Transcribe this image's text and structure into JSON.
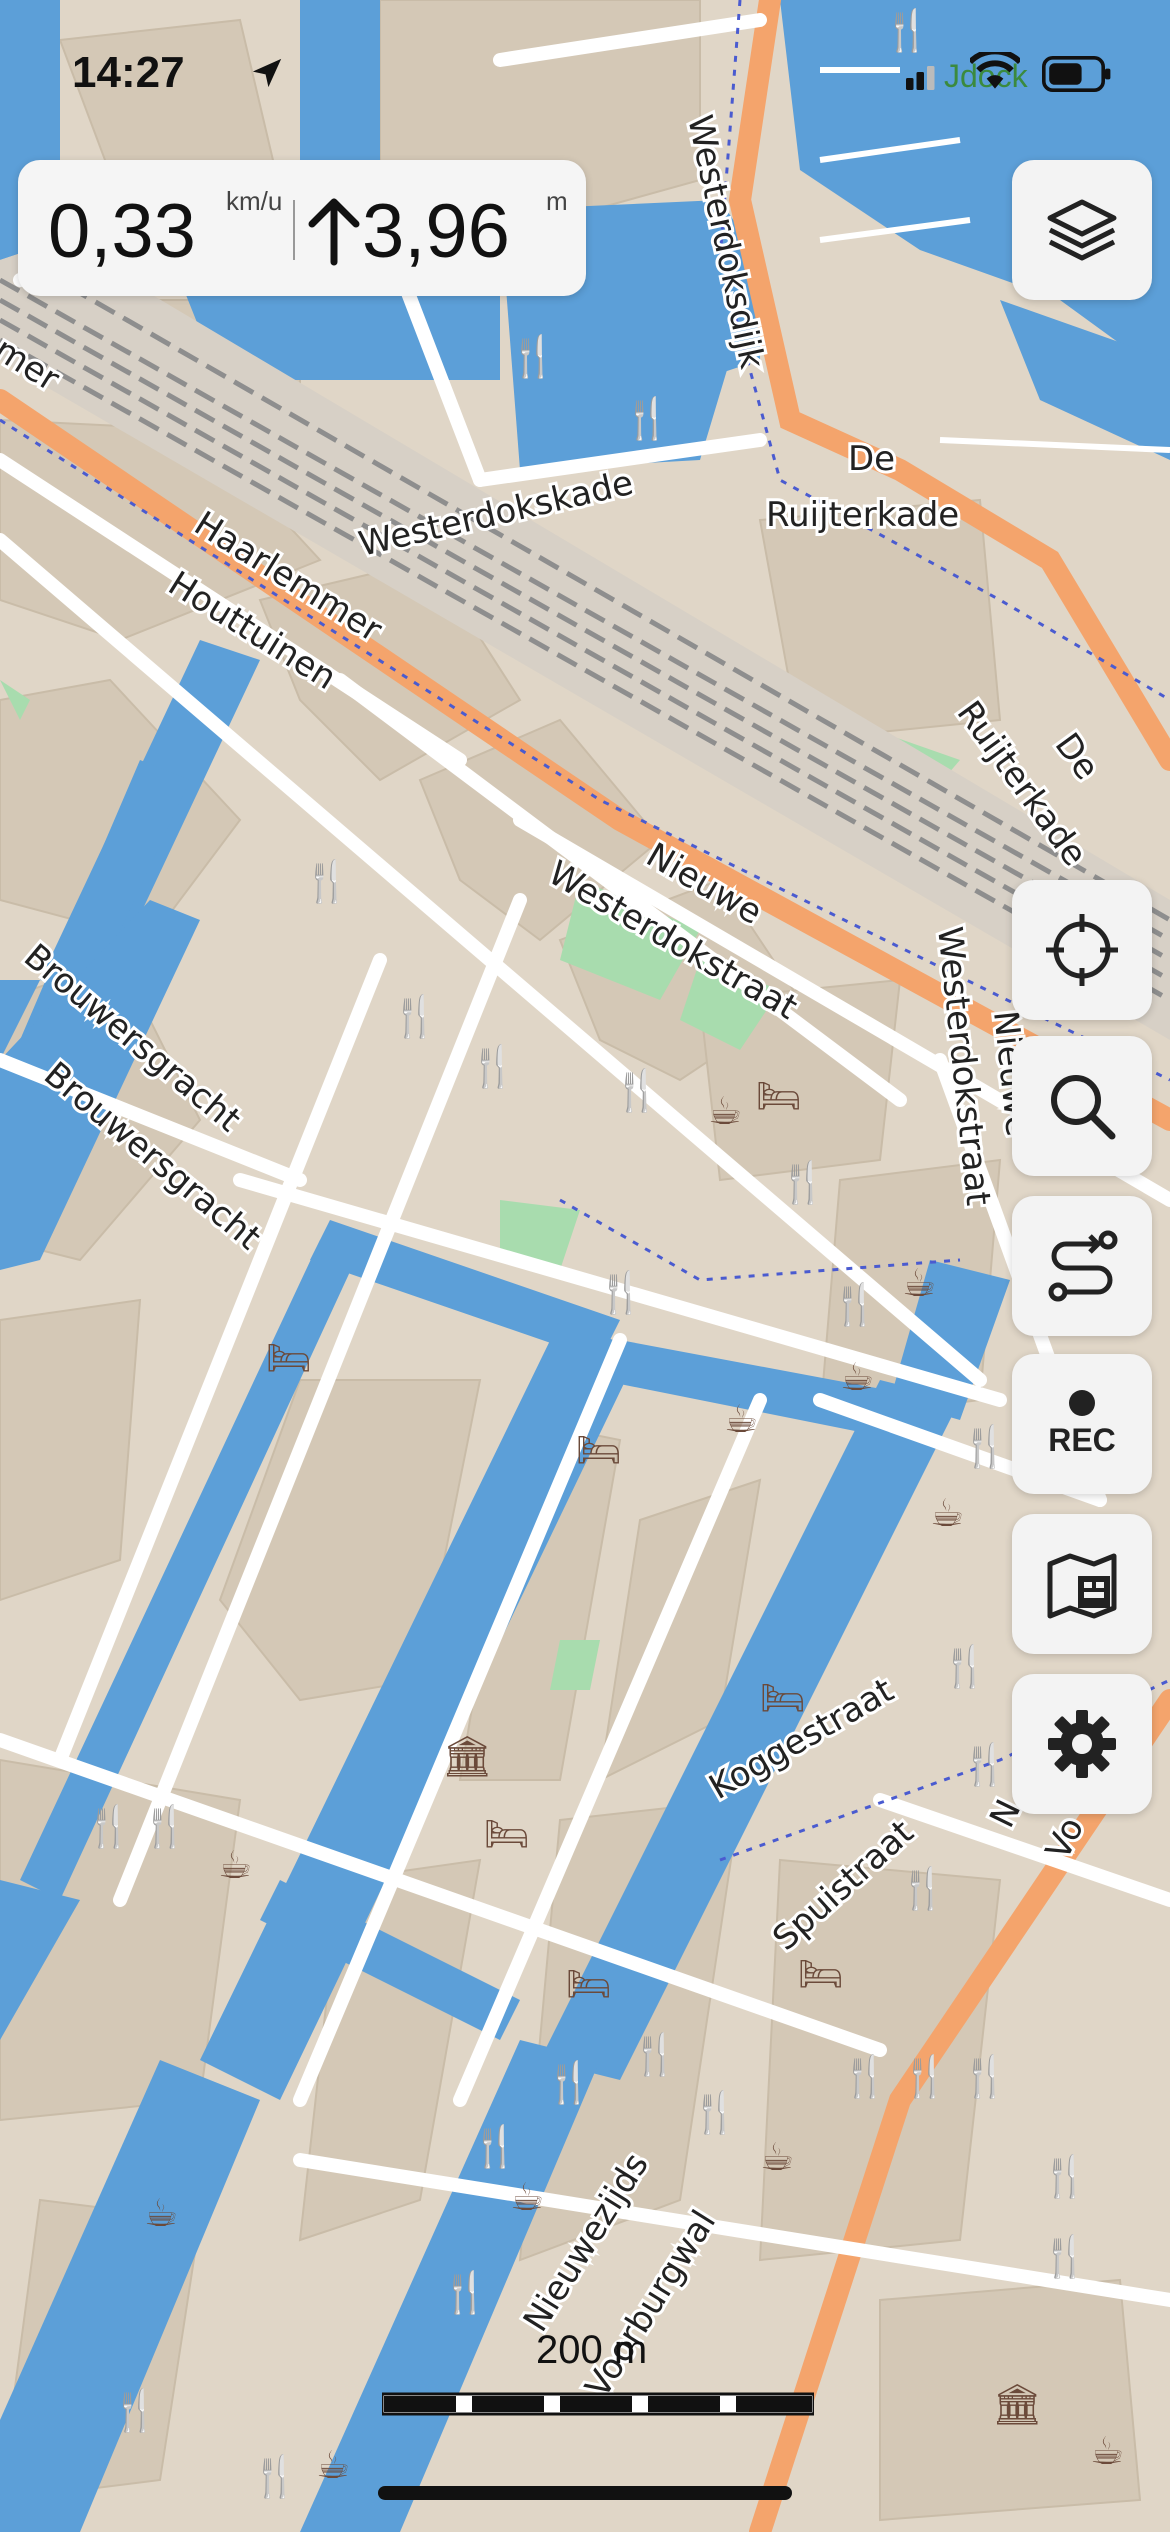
{
  "status_bar": {
    "time": "14:27",
    "carrier": "Jdock",
    "icons": [
      "location-arrow-icon",
      "signal-icon",
      "wifi-icon",
      "battery-icon"
    ]
  },
  "speed_panel": {
    "speed_value": "0,33",
    "speed_unit": "km/u",
    "ascent_value": "3,96",
    "ascent_unit": "m",
    "icons": [
      "arrow-up-icon"
    ]
  },
  "controls": {
    "layers_icon": "layers-icon",
    "locate_icon": "crosshair-icon",
    "search_icon": "search-icon",
    "route_icon": "route-icon",
    "rec_label": "REC",
    "map_sources_icon": "map-card-icon",
    "settings_icon": "gear-icon"
  },
  "map": {
    "labels": {
      "westerdoksdijk": "Westerdoksdijk",
      "de_1": "De",
      "ruijterkade_1": "Ruijterkade",
      "westerdokskade": "Westerdokskade",
      "haarlemmer": "Haarlemmer",
      "houttuinen": "Houttuinen",
      "mer": "mer",
      "de_2": "De",
      "ruijterkade_2": "Ruijterkade",
      "nieuwe": "Nieuwe",
      "westerdokstraat": "Westerdokstraat",
      "westerdokstraat_v": "Westerdokstraat",
      "nieuwe_v": "Nieuwe",
      "brouwersgracht_1": "Brouwersgracht",
      "brouwersgracht_2": "Brouwersgracht",
      "koggestraat": "Koggestraat",
      "spuistraat": "Spuistraat",
      "nieuwezijds": "Nieuwezijds",
      "voorburgwal": "Voorburgwal",
      "vo": "Vo",
      "nz": "N"
    },
    "colors": {
      "water": "#5c9fd8",
      "land": "#e0d6c7",
      "building": "#d4c8b6",
      "road": "#ffffff",
      "major_road": "#f4a46c",
      "rail": "#9a9a9a",
      "park": "#a8dcae",
      "poi": "#6b4a3a"
    },
    "scale_label": "200 m"
  }
}
